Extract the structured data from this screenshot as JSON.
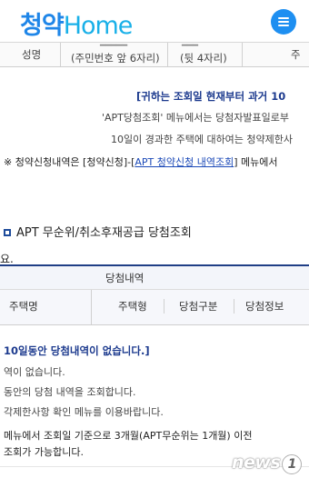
{
  "header": {
    "logo_part1": "청약",
    "logo_part2": "Home",
    "menu_icon": "hamburger-menu-icon"
  },
  "top_table": {
    "col1": "성명",
    "col2": "(주민번호 앞 6자리)",
    "col3": "(뒷 4자리)",
    "col4": "주"
  },
  "notices": {
    "line1": "[귀하는 조회일 현재부터 과거 10",
    "line2": "'APT당첨조회' 메뉴에서는 당첨자발표일로부",
    "line3": "10일이 경과한 주택에 대하여는 청약제한사",
    "line4_prefix": "※ 청약신청내역은 [청약신청]-[",
    "line4_link": "APT 청약신청 내역조회",
    "line4_suffix": "] 메뉴에서"
  },
  "section": {
    "title": "APT 무순위/취소후재공급 당첨조회",
    "result_label": "요."
  },
  "table2": {
    "group_header": "당첨내역",
    "headers": [
      "주택명",
      "주택형",
      "당첨구분",
      "당첨정보"
    ]
  },
  "results": {
    "line1": "10일동안 당첨내역이 없습니다.]",
    "line2": "역이 없습니다.",
    "line3": "동안의 당첨 내역을 조회합니다.",
    "line4": "각제한사항 확인 메뉴를 이용바랍니다.",
    "line5": "메뉴에서 조회일 기준으로 3개월(APT무순위는 1개월) 이전",
    "line6": "조회가 가능합니다."
  },
  "watermark": {
    "text": "news",
    "number": "1"
  }
}
